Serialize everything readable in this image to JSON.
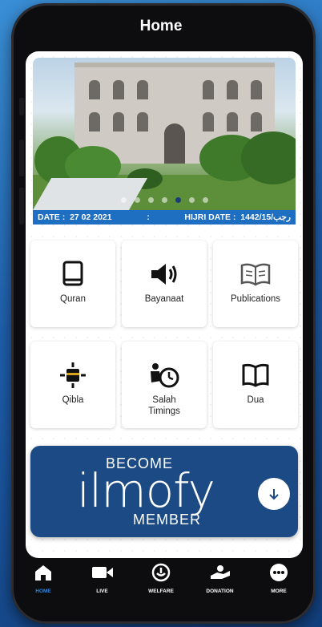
{
  "header": {
    "title": "Home"
  },
  "banner": {
    "slides": 7,
    "active_slide": 5,
    "date_label": "DATE :",
    "date_value": "27 02 2021",
    "separator": ":",
    "hijri_label": "HIJRI DATE :",
    "hijri_value": "1442/15/رجب"
  },
  "tiles": [
    {
      "label": "Quran",
      "icon": "book-icon"
    },
    {
      "label": "Bayanaat",
      "icon": "speaker-icon"
    },
    {
      "label": "Publications",
      "icon": "open-book-icon"
    },
    {
      "label": "Qibla",
      "icon": "compass-icon"
    },
    {
      "label": "Salah Timings",
      "icon": "prayer-clock-icon"
    },
    {
      "label": "Dua",
      "icon": "dua-book-icon"
    }
  ],
  "cta": {
    "top": "BECOME",
    "brand": "ilmofy",
    "bottom": "MEMBER",
    "icon": "arrow-down-icon"
  },
  "nav": [
    {
      "label": "HOME",
      "icon": "home-icon",
      "active": true
    },
    {
      "label": "LIVE",
      "icon": "video-icon",
      "active": false
    },
    {
      "label": "WELFARE",
      "icon": "welfare-icon",
      "active": false
    },
    {
      "label": "DONATION",
      "icon": "donation-icon",
      "active": false
    },
    {
      "label": "MORE",
      "icon": "more-icon",
      "active": false
    }
  ],
  "colors": {
    "accent": "#1e6fc1",
    "cta": "#1c4a84",
    "active_nav": "#2d86e0"
  }
}
